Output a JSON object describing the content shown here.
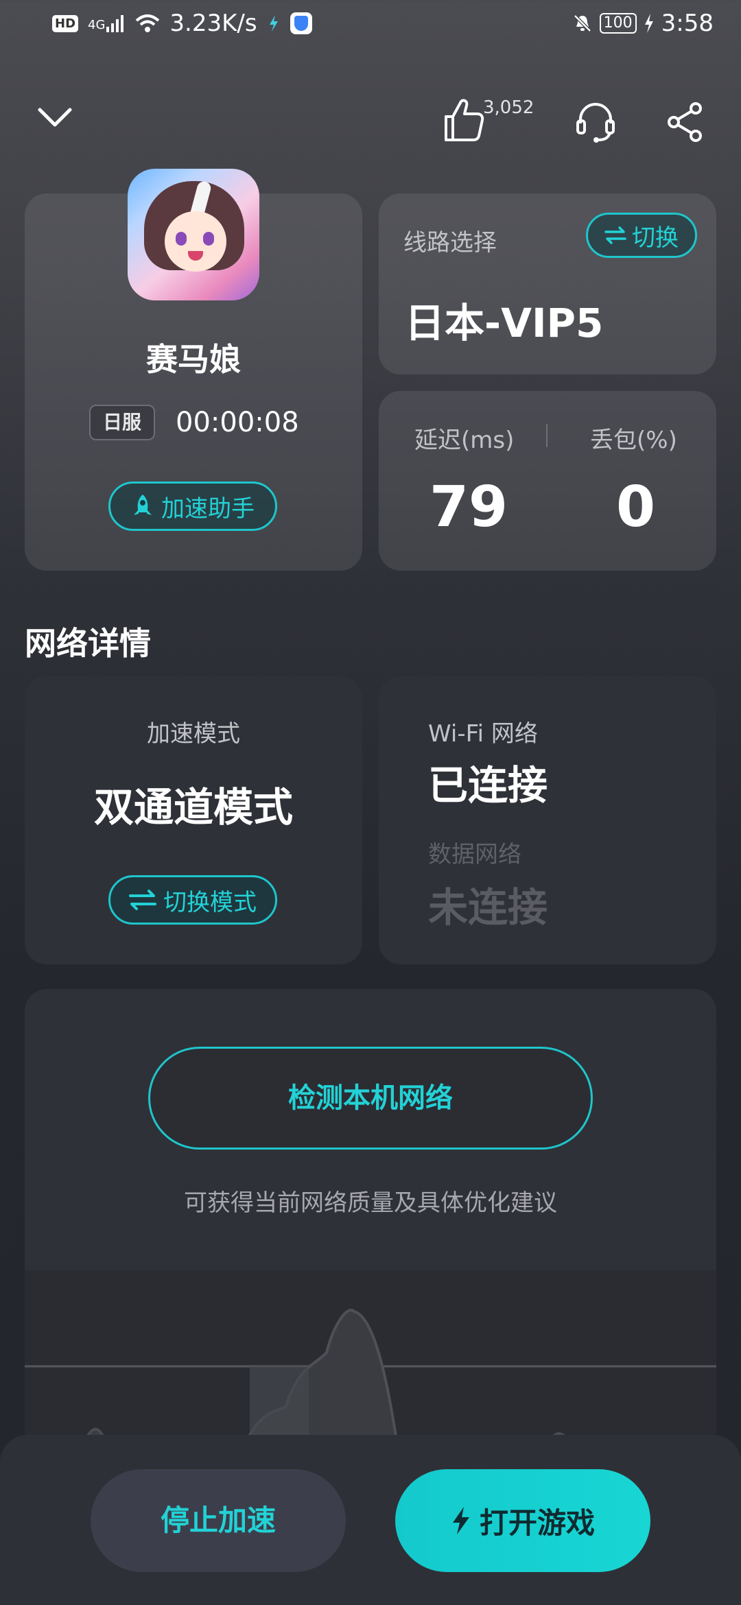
{
  "status_bar": {
    "hd": "HD",
    "network": "4G",
    "speed": "3.23K/s",
    "battery": "100",
    "time": "3:58"
  },
  "top_bar": {
    "like_count": "3,052"
  },
  "game": {
    "name": "赛马娘",
    "region": "日服",
    "timer": "00:00:08",
    "assist_label": "加速助手"
  },
  "route": {
    "label": "线路选择",
    "switch_label": "切换",
    "value": "日本-VIP5"
  },
  "stats": {
    "latency_label": "延迟(ms)",
    "latency_value": "79",
    "loss_label": "丢包(%)",
    "loss_value": "0"
  },
  "network_details": {
    "title": "网络详情",
    "mode_label": "加速模式",
    "mode_value": "双通道模式",
    "mode_switch_label": "切换模式",
    "wifi_label": "Wi-Fi 网络",
    "wifi_value": "已连接",
    "data_label": "数据网络",
    "data_value": "未连接"
  },
  "detect": {
    "button_label": "检测本机网络",
    "description": "可获得当前网络质量及具体优化建议"
  },
  "bottom": {
    "stop_label": "停止加速",
    "open_label": "打开游戏"
  },
  "colors": {
    "accent": "#1ec6cc",
    "primary_button": "#14c9cc",
    "secondary_button": "#3c3f4b"
  }
}
